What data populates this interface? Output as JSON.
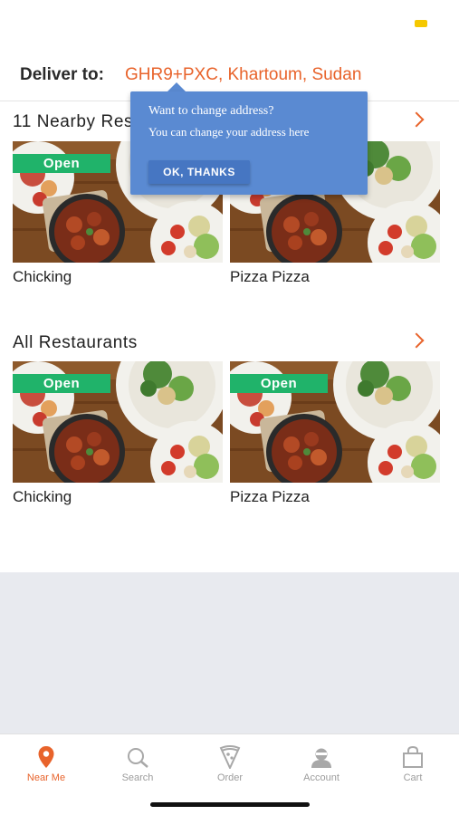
{
  "header": {
    "deliver_label": "Deliver to:",
    "address": "GHR9+PXC, Khartoum, Sudan"
  },
  "tooltip": {
    "title": "Want to change address?",
    "text": "You can change your address here",
    "button": "OK, THANKS"
  },
  "sections": [
    {
      "title": "11 Nearby Restaurants",
      "restaurants": [
        {
          "name": "Chicking",
          "badge": "Open"
        },
        {
          "name": "Pizza Pizza",
          "badge": ""
        }
      ]
    },
    {
      "title": "All Restaurants",
      "restaurants": [
        {
          "name": "Chicking",
          "badge": "Open"
        },
        {
          "name": "Pizza Pizza",
          "badge": "Open"
        }
      ]
    }
  ],
  "tabs": [
    {
      "label": "Near Me",
      "icon": "location-pin-icon",
      "active": true
    },
    {
      "label": "Search",
      "icon": "search-icon",
      "active": false
    },
    {
      "label": "Order",
      "icon": "pizza-slice-icon",
      "active": false
    },
    {
      "label": "Account",
      "icon": "account-icon",
      "active": false
    },
    {
      "label": "Cart",
      "icon": "cart-bag-icon",
      "active": false
    }
  ],
  "colors": {
    "accent": "#e8632b",
    "open_badge": "#20b36a",
    "tooltip": "#5a8ad2"
  }
}
